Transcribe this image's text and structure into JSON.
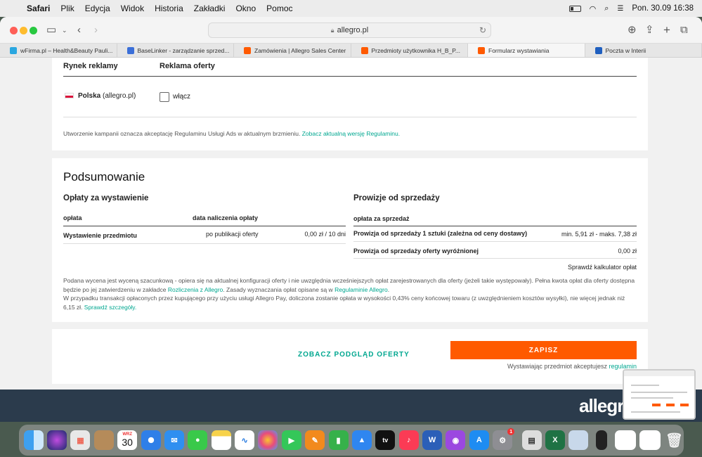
{
  "menubar": {
    "items": [
      "Safari",
      "Plik",
      "Edycja",
      "Widok",
      "Historia",
      "Zakładki",
      "Okno",
      "Pomoc"
    ],
    "datetime": "Pon. 30.09  16:38"
  },
  "browser": {
    "url": "allegro.pl",
    "tabs": [
      {
        "label": "wFirma.pl – Health&Beauty Pauli...",
        "color": "#2aa7e0"
      },
      {
        "label": "BaseLinker - zarządzanie sprzed...",
        "color": "#3b6fd8"
      },
      {
        "label": "Zamówienia | Allegro Sales Center",
        "color": "#ff5a00"
      },
      {
        "label": "Przedmioty użytkownika H_B_P...",
        "color": "#ff5a00"
      },
      {
        "label": "Formularz wystawiania",
        "color": "#ff5a00"
      },
      {
        "label": "Poczta w Interii",
        "color": "#1f5fbf"
      }
    ]
  },
  "ads": {
    "col_market": "Rynek reklamy",
    "col_ad": "Reklama oferty",
    "market_name": "Polska",
    "market_domain": "(allegro.pl)",
    "checkbox_label": "włącz",
    "notice": "Utworzenie kampanii oznacza akceptację Regulaminu Usługi Ads w aktualnym brzmieniu.",
    "notice_link": "Zobacz aktualną wersję Regulaminu."
  },
  "summary": {
    "title": "Podsumowanie",
    "fees_title": "Opłaty za wystawienie",
    "fees_col_fee": "opłata",
    "fees_col_date": "data naliczenia opłaty",
    "fees_row": {
      "name": "Wystawienie przedmiotu",
      "date": "po publikacji oferty",
      "amount": "0,00 zł / 10 dni"
    },
    "commission_title": "Prowizje od sprzedaży",
    "commission_col": "opłata za sprzedaż",
    "commission_rows": [
      {
        "name": "Prowizja od sprzedaży 1 sztuki (zależna od ceny dostawy)",
        "amount": "min. 5,91 zł - maks. 7,38 zł"
      },
      {
        "name": "Prowizja od sprzedaży oferty wyróżnionej",
        "amount": "0,00 zł"
      }
    ],
    "calculator_link": "Sprawdź kalkulator opłat",
    "note1_a": "Podana wycena jest wyceną szacunkową - opiera się na aktualnej konfiguracji oferty i nie uwzględnia wcześniejszych opłat zarejestrowanych dla oferty (jeżeli takie występowały). Pełna kwota opłat dla oferty dostępna będzie po jej zatwierdzeniu w zakładce",
    "note1_link1": "Rozliczenia z Allegro",
    "note1_b": ". Zasady wyznaczania opłat opisane są w",
    "note1_link2": "Regulaminie Allegro",
    "note1_c": ".",
    "note2": "W przypadku transakcji opłaconych przez kupującego przy użyciu usługi Allegro Pay, doliczona zostanie opłata w wysokości 0,43% ceny końcowej towaru (z uwzględnieniem kosztów wysyłki), nie więcej jednak niż 6,15 zł.",
    "note2_link": "Sprawdź szczegóły."
  },
  "actions": {
    "preview": "ZOBACZ PODGLĄD OFERTY",
    "save": "ZAPISZ",
    "accept_text": "Wystawiając przedmiot akceptujesz",
    "accept_link": "regulamin"
  },
  "footer": {
    "logo": "allegro"
  },
  "dock": {
    "calendar_month": "WRZ",
    "calendar_day": "30",
    "settings_badge": "1"
  },
  "colors": {
    "accent": "#ff5a00",
    "link": "#00a790"
  }
}
